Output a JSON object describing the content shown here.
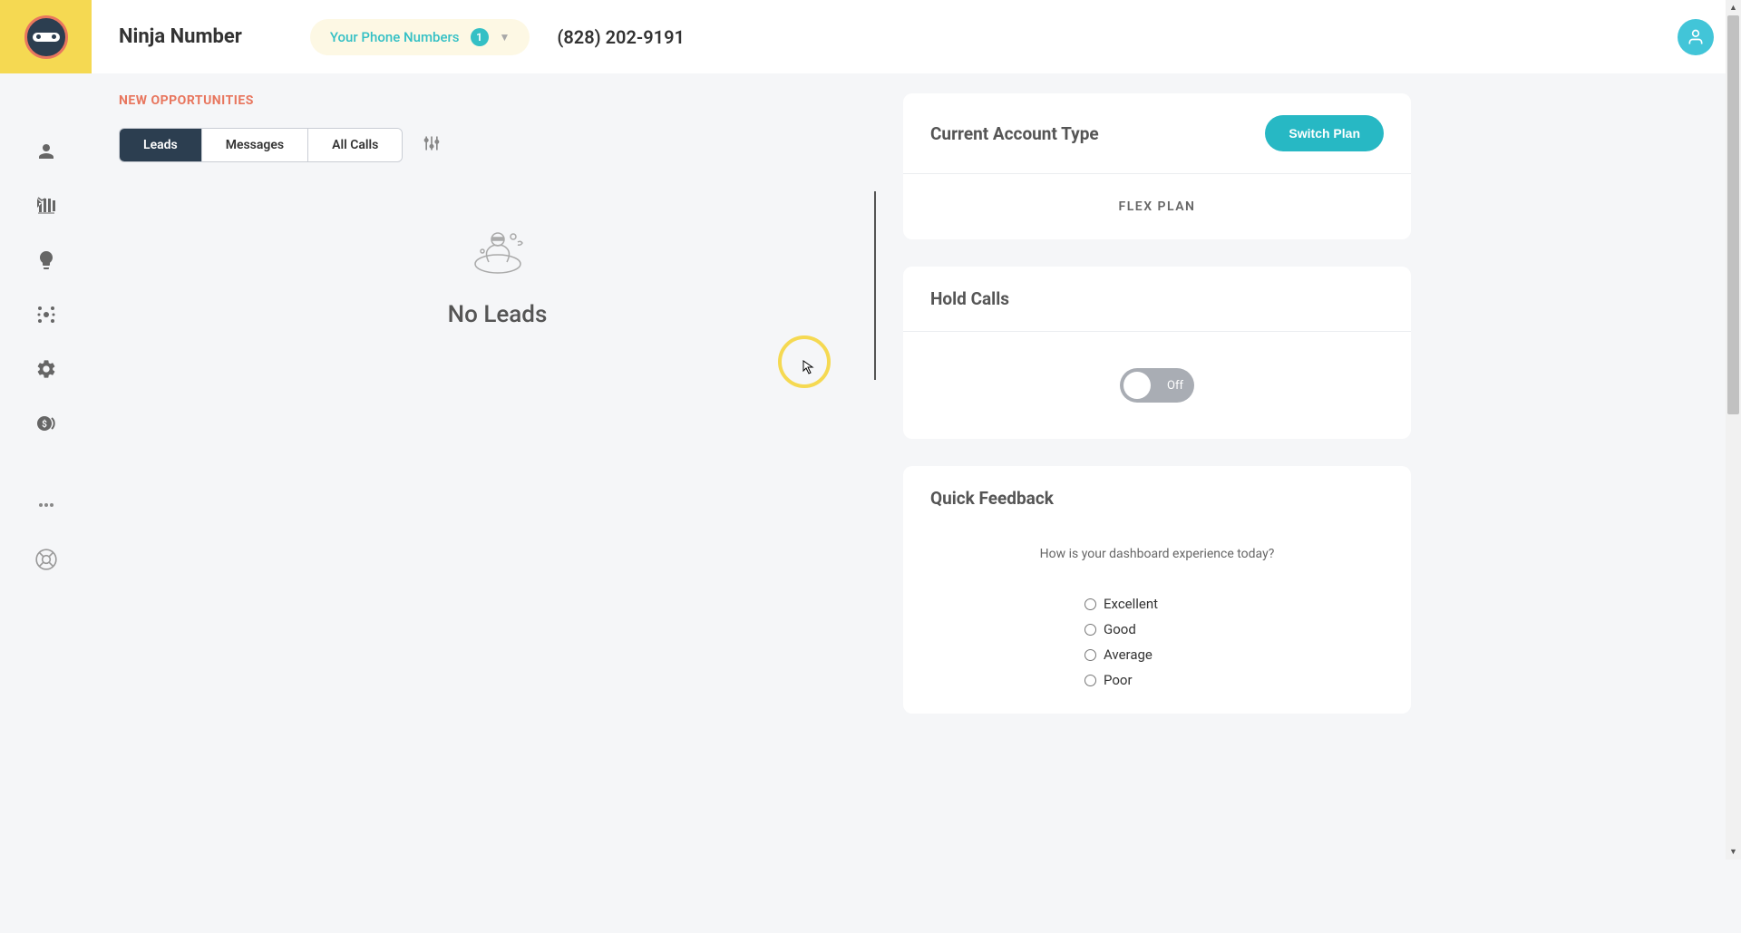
{
  "header": {
    "app_title": "Ninja Number",
    "phone_dropdown_label": "Your Phone Numbers",
    "phone_count": "1",
    "phone_number": "(828) 202-9191"
  },
  "opportunities": {
    "title": "NEW OPPORTUNITIES",
    "tabs": {
      "leads": "Leads",
      "messages": "Messages",
      "all_calls": "All Calls"
    },
    "empty_text": "No Leads"
  },
  "account": {
    "title": "Current Account Type",
    "switch_button": "Switch Plan",
    "plan_name": "FLEX PLAN"
  },
  "hold_calls": {
    "title": "Hold Calls",
    "toggle_label": "Off"
  },
  "feedback": {
    "title": "Quick Feedback",
    "question": "How is your dashboard experience today?",
    "options": {
      "excellent": "Excellent",
      "good": "Good",
      "average": "Average",
      "poor": "Poor"
    }
  }
}
